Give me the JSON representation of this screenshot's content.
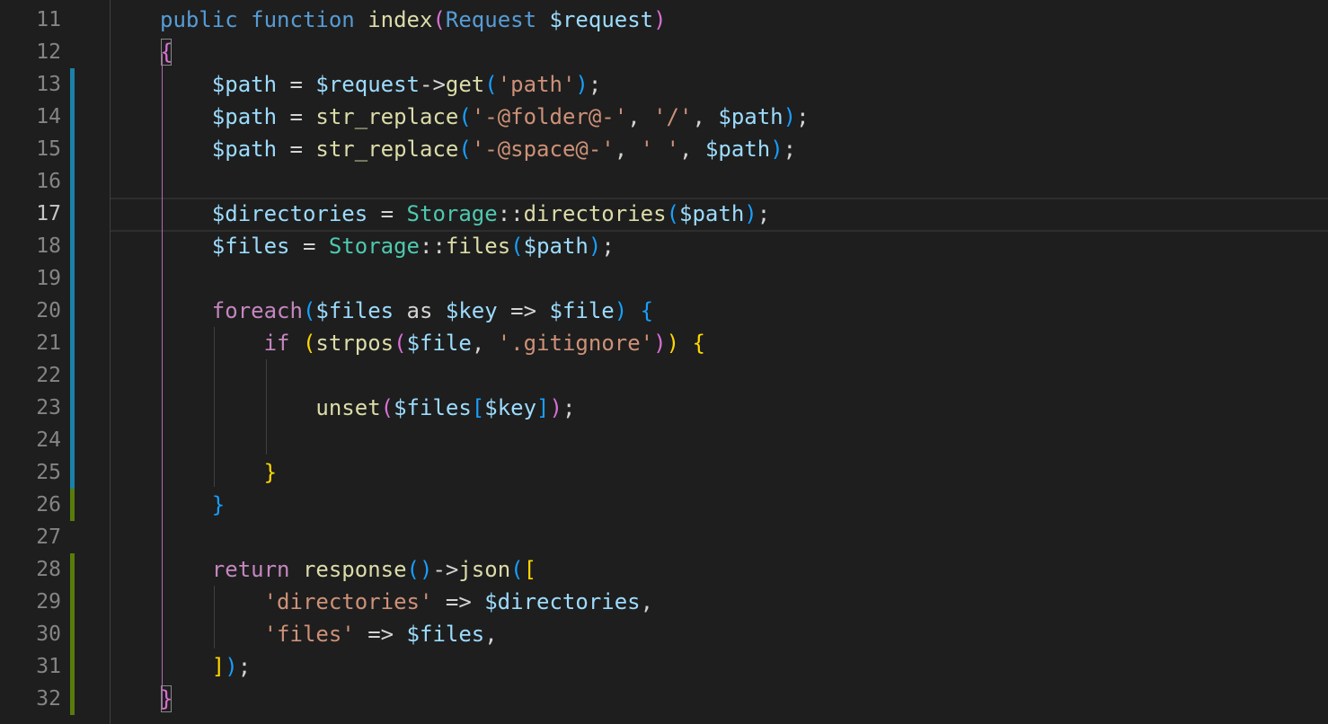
{
  "editor": {
    "language": "php",
    "theme": "dark",
    "active_line": "17",
    "colors": {
      "background": "#1e1e1e",
      "keyword": "#569cd6",
      "control": "#c586c0",
      "function": "#dcdcaa",
      "type": "#4ec9b0",
      "variable": "#9cdcfe",
      "string": "#ce9178",
      "modified_bar": "#1b81a8",
      "added_bar": "#587c0c"
    },
    "lines": [
      {
        "num": "11",
        "change": "none",
        "tokens": [
          {
            "t": "public",
            "c": "kw"
          },
          {
            "t": " ",
            "c": "op"
          },
          {
            "t": "function",
            "c": "kw"
          },
          {
            "t": " ",
            "c": "op"
          },
          {
            "t": "index",
            "c": "fn"
          },
          {
            "t": "(",
            "c": "p2"
          },
          {
            "t": "Request",
            "c": "kw"
          },
          {
            "t": " ",
            "c": "op"
          },
          {
            "t": "$request",
            "c": "var"
          },
          {
            "t": ")",
            "c": "p2"
          }
        ]
      },
      {
        "num": "12",
        "change": "none",
        "tokens": [
          {
            "t": "{",
            "c": "p2"
          }
        ]
      },
      {
        "num": "13",
        "change": "modified",
        "tokens": [
          {
            "t": "    ",
            "c": "op"
          },
          {
            "t": "$path",
            "c": "var"
          },
          {
            "t": " = ",
            "c": "op"
          },
          {
            "t": "$request",
            "c": "var"
          },
          {
            "t": "->",
            "c": "op"
          },
          {
            "t": "get",
            "c": "fn"
          },
          {
            "t": "(",
            "c": "p3"
          },
          {
            "t": "'path'",
            "c": "str"
          },
          {
            "t": ")",
            "c": "p3"
          },
          {
            "t": ";",
            "c": "op"
          }
        ]
      },
      {
        "num": "14",
        "change": "modified",
        "tokens": [
          {
            "t": "    ",
            "c": "op"
          },
          {
            "t": "$path",
            "c": "var"
          },
          {
            "t": " = ",
            "c": "op"
          },
          {
            "t": "str_replace",
            "c": "fn"
          },
          {
            "t": "(",
            "c": "p3"
          },
          {
            "t": "'-@folder@-'",
            "c": "str"
          },
          {
            "t": ", ",
            "c": "op"
          },
          {
            "t": "'/'",
            "c": "str"
          },
          {
            "t": ", ",
            "c": "op"
          },
          {
            "t": "$path",
            "c": "var"
          },
          {
            "t": ")",
            "c": "p3"
          },
          {
            "t": ";",
            "c": "op"
          }
        ]
      },
      {
        "num": "15",
        "change": "modified",
        "tokens": [
          {
            "t": "    ",
            "c": "op"
          },
          {
            "t": "$path",
            "c": "var"
          },
          {
            "t": " = ",
            "c": "op"
          },
          {
            "t": "str_replace",
            "c": "fn"
          },
          {
            "t": "(",
            "c": "p3"
          },
          {
            "t": "'-@space@-'",
            "c": "str"
          },
          {
            "t": ", ",
            "c": "op"
          },
          {
            "t": "' '",
            "c": "str"
          },
          {
            "t": ", ",
            "c": "op"
          },
          {
            "t": "$path",
            "c": "var"
          },
          {
            "t": ")",
            "c": "p3"
          },
          {
            "t": ";",
            "c": "op"
          }
        ]
      },
      {
        "num": "16",
        "change": "modified",
        "tokens": []
      },
      {
        "num": "17",
        "change": "modified",
        "tokens": [
          {
            "t": "    ",
            "c": "op"
          },
          {
            "t": "$directories",
            "c": "var"
          },
          {
            "t": " = ",
            "c": "op"
          },
          {
            "t": "Storage",
            "c": "type"
          },
          {
            "t": "::",
            "c": "op"
          },
          {
            "t": "directories",
            "c": "fn"
          },
          {
            "t": "(",
            "c": "p3"
          },
          {
            "t": "$path",
            "c": "var"
          },
          {
            "t": ")",
            "c": "p3"
          },
          {
            "t": ";",
            "c": "op"
          }
        ]
      },
      {
        "num": "18",
        "change": "modified",
        "tokens": [
          {
            "t": "    ",
            "c": "op"
          },
          {
            "t": "$files",
            "c": "var"
          },
          {
            "t": " = ",
            "c": "op"
          },
          {
            "t": "Storage",
            "c": "type"
          },
          {
            "t": "::",
            "c": "op"
          },
          {
            "t": "files",
            "c": "fn"
          },
          {
            "t": "(",
            "c": "p3"
          },
          {
            "t": "$path",
            "c": "var"
          },
          {
            "t": ")",
            "c": "p3"
          },
          {
            "t": ";",
            "c": "op"
          }
        ]
      },
      {
        "num": "19",
        "change": "modified",
        "tokens": []
      },
      {
        "num": "20",
        "change": "modified",
        "tokens": [
          {
            "t": "    ",
            "c": "op"
          },
          {
            "t": "foreach",
            "c": "ctl"
          },
          {
            "t": "(",
            "c": "p3"
          },
          {
            "t": "$files",
            "c": "var"
          },
          {
            "t": " as ",
            "c": "op"
          },
          {
            "t": "$key",
            "c": "var"
          },
          {
            "t": " => ",
            "c": "op"
          },
          {
            "t": "$file",
            "c": "var"
          },
          {
            "t": ")",
            "c": "p3"
          },
          {
            "t": " ",
            "c": "op"
          },
          {
            "t": "{",
            "c": "p3"
          }
        ]
      },
      {
        "num": "21",
        "change": "modified",
        "tokens": [
          {
            "t": "        ",
            "c": "op"
          },
          {
            "t": "if",
            "c": "ctl"
          },
          {
            "t": " ",
            "c": "op"
          },
          {
            "t": "(",
            "c": "p1"
          },
          {
            "t": "strpos",
            "c": "fn"
          },
          {
            "t": "(",
            "c": "p2"
          },
          {
            "t": "$file",
            "c": "var"
          },
          {
            "t": ", ",
            "c": "op"
          },
          {
            "t": "'.gitignore'",
            "c": "str"
          },
          {
            "t": ")",
            "c": "p2"
          },
          {
            "t": ")",
            "c": "p1"
          },
          {
            "t": " ",
            "c": "op"
          },
          {
            "t": "{",
            "c": "p1"
          }
        ]
      },
      {
        "num": "22",
        "change": "modified",
        "tokens": []
      },
      {
        "num": "23",
        "change": "modified",
        "tokens": [
          {
            "t": "            ",
            "c": "op"
          },
          {
            "t": "unset",
            "c": "fn"
          },
          {
            "t": "(",
            "c": "p2"
          },
          {
            "t": "$files",
            "c": "var"
          },
          {
            "t": "[",
            "c": "p3"
          },
          {
            "t": "$key",
            "c": "var"
          },
          {
            "t": "]",
            "c": "p3"
          },
          {
            "t": ")",
            "c": "p2"
          },
          {
            "t": ";",
            "c": "op"
          }
        ]
      },
      {
        "num": "24",
        "change": "modified",
        "tokens": []
      },
      {
        "num": "25",
        "change": "modified",
        "tokens": [
          {
            "t": "        ",
            "c": "op"
          },
          {
            "t": "}",
            "c": "p1"
          }
        ]
      },
      {
        "num": "26",
        "change": "added",
        "tokens": [
          {
            "t": "    ",
            "c": "op"
          },
          {
            "t": "}",
            "c": "p3"
          }
        ]
      },
      {
        "num": "27",
        "change": "none",
        "tokens": []
      },
      {
        "num": "28",
        "change": "added",
        "tokens": [
          {
            "t": "    ",
            "c": "op"
          },
          {
            "t": "return",
            "c": "ctl"
          },
          {
            "t": " ",
            "c": "op"
          },
          {
            "t": "response",
            "c": "fn"
          },
          {
            "t": "()",
            "c": "p3"
          },
          {
            "t": "->",
            "c": "op"
          },
          {
            "t": "json",
            "c": "fn"
          },
          {
            "t": "(",
            "c": "p3"
          },
          {
            "t": "[",
            "c": "p1"
          }
        ]
      },
      {
        "num": "29",
        "change": "added",
        "tokens": [
          {
            "t": "        ",
            "c": "op"
          },
          {
            "t": "'directories'",
            "c": "str"
          },
          {
            "t": " => ",
            "c": "op"
          },
          {
            "t": "$directories",
            "c": "var"
          },
          {
            "t": ",",
            "c": "op"
          }
        ]
      },
      {
        "num": "30",
        "change": "added",
        "tokens": [
          {
            "t": "        ",
            "c": "op"
          },
          {
            "t": "'files'",
            "c": "str"
          },
          {
            "t": " => ",
            "c": "op"
          },
          {
            "t": "$files",
            "c": "var"
          },
          {
            "t": ",",
            "c": "op"
          }
        ]
      },
      {
        "num": "31",
        "change": "added",
        "tokens": [
          {
            "t": "    ",
            "c": "op"
          },
          {
            "t": "]",
            "c": "p1"
          },
          {
            "t": ")",
            "c": "p3"
          },
          {
            "t": ";",
            "c": "op"
          }
        ]
      },
      {
        "num": "32",
        "change": "added",
        "tokens": [
          {
            "t": "}",
            "c": "p2"
          }
        ]
      }
    ]
  }
}
